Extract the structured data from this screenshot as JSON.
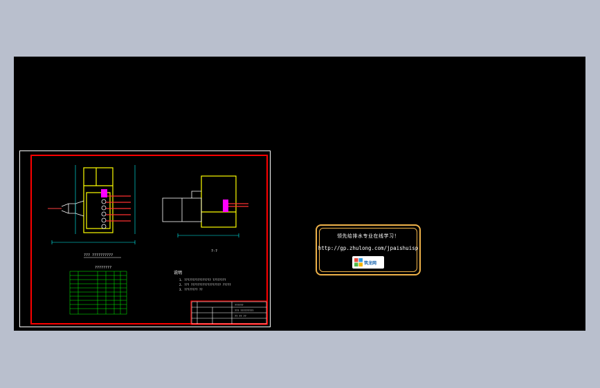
{
  "viewport": {
    "background": "#000000",
    "workspace_background": "#b9bfcd"
  },
  "ad": {
    "headline": "领先给排水专业在线学习！",
    "url": "http://gp.zhulong.com/jpaishuisp",
    "logo_text": "筑龙网",
    "border_color": "#f0b34a"
  },
  "drawing": {
    "frame_color": "#ff0000",
    "line_color": "#ffff00",
    "dim_color": "#00ffff",
    "table_color": "#00ff00",
    "accent_color": "#ff00ff",
    "plan_caption": "??? ??????????",
    "table_caption": "????????",
    "notes_heading": "说明",
    "notes": [
      "1. ???????????????? ????????",
      "2. ??? ?????????????????? ?????",
      "3. ???????? ??"
    ],
    "section_caption": "?-?",
    "title_block": {
      "company": "??????",
      "drawing_name": "??? ?????????",
      "sheet_label": "?? ?? ??"
    }
  }
}
